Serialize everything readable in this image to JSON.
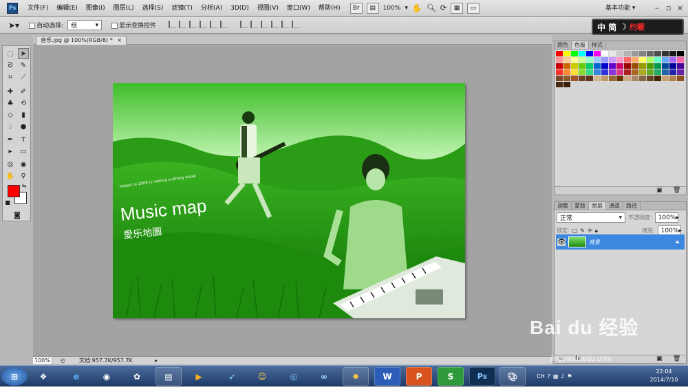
{
  "app": {
    "logo": "Ps"
  },
  "menubar": {
    "items": [
      "文件(F)",
      "编辑(E)",
      "图像(I)",
      "图层(L)",
      "选择(S)",
      "滤镜(T)",
      "分析(A)",
      "3D(D)",
      "视图(V)",
      "窗口(W)",
      "帮助(H)"
    ],
    "zoom": "100%",
    "workspace": "基本功能",
    "icons": [
      "bridge-icon",
      "mini-bridge-icon",
      "hand-icon",
      "zoom-icon",
      "rotate-icon",
      "arrange-icon",
      "screen-mode-icon"
    ]
  },
  "options": {
    "auto_select_label": "自动选择:",
    "auto_select_value": "组",
    "show_transform_label": "显示变换控件"
  },
  "badge": {
    "text": "中 简",
    "mark": "约暖"
  },
  "document": {
    "tab_label": "音乐.jpg @ 100%(RGB/8) *",
    "close": "×"
  },
  "image": {
    "tagline": "Impact in 2009 is making a strong visual",
    "title": "Music map",
    "subtitle": "愛乐地圖"
  },
  "status": {
    "zoom": "100%",
    "doc_info": "文档:957.7K/957.7K"
  },
  "swatch_panel": {
    "tabs": [
      "颜色",
      "色板",
      "样式"
    ],
    "active": 1,
    "colors": [
      "#ff0000",
      "#ffff00",
      "#00ff00",
      "#00ffff",
      "#0000ff",
      "#ff00ff",
      "#ffffff",
      "#e6e6e6",
      "#cccccc",
      "#b3b3b3",
      "#999999",
      "#808080",
      "#666666",
      "#4d4d4d",
      "#333333",
      "#1a1a1a",
      "#000000",
      "#ff9999",
      "#ffcc99",
      "#ffff99",
      "#ccff99",
      "#99ffcc",
      "#99ccff",
      "#9999ff",
      "#cc99ff",
      "#ff99cc",
      "#ff6666",
      "#ffaa66",
      "#ffff66",
      "#aaff66",
      "#66ffcc",
      "#66aaff",
      "#aa66ff",
      "#ff66aa",
      "#cc0000",
      "#cc6600",
      "#cccc00",
      "#66cc00",
      "#00cc66",
      "#0066cc",
      "#0000cc",
      "#6600cc",
      "#cc0066",
      "#990000",
      "#994c00",
      "#999900",
      "#4c9900",
      "#00994c",
      "#004c99",
      "#000099",
      "#4c0099",
      "#ff3333",
      "#ff8833",
      "#ffdd33",
      "#88dd33",
      "#33dd88",
      "#3388dd",
      "#3333dd",
      "#8833dd",
      "#dd3388",
      "#aa2222",
      "#aa6622",
      "#aaaa22",
      "#66aa22",
      "#22aa66",
      "#2266aa",
      "#2222aa",
      "#6622aa",
      "#7a4a2a",
      "#8b5a2b",
      "#a0522d",
      "#6b4226",
      "#5c3317",
      "#d2b48c",
      "#c19a6b",
      "#996633",
      "#663300",
      "#ccaa88",
      "#aa8866",
      "#886644",
      "#664422",
      "#442200",
      "#c8a070",
      "#b08050",
      "#905020",
      "#4a2a10",
      "#3a2008"
    ]
  },
  "layers_panel": {
    "tabs": [
      "调整",
      "蒙版",
      "图层",
      "通道",
      "路径"
    ],
    "active": 2,
    "blend_mode": "正常",
    "opacity_label": "不透明度:",
    "opacity_value": "100%",
    "lock_label": "锁定:",
    "fill_label": "填充:",
    "fill_value": "100%",
    "layer_name": "背景"
  },
  "taskbar": {
    "apps": [
      "start",
      "windows-icon",
      "ie-icon",
      "chrome-icon",
      "photos-icon",
      "explorer-icon",
      "media-icon",
      "bird-icon",
      "qq-icon",
      "circle-icon",
      "cloud-icon",
      "tool-icon",
      "W",
      "P",
      "S",
      "Ps",
      "paint-icon"
    ],
    "tray_lang": "CH",
    "time": "22:04",
    "date": "2014/7/10"
  },
  "watermark": {
    "brand": "Bai du 经验",
    "url": "jingyan.baidu.com"
  }
}
